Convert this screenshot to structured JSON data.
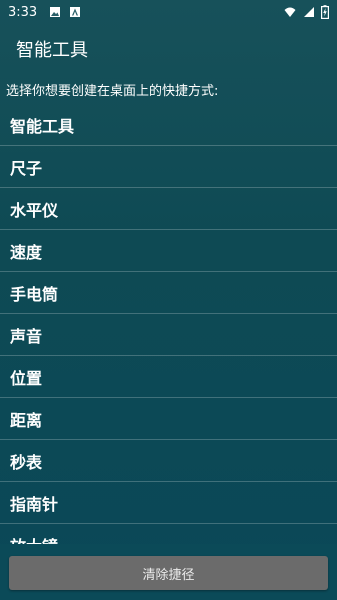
{
  "status_bar": {
    "time": "3:33",
    "left_icons": [
      "image-icon",
      "a-letter-icon"
    ],
    "right_icons": [
      "wifi-icon",
      "signal-icon",
      "battery-charging-icon"
    ]
  },
  "header": {
    "title": "智能工具"
  },
  "prompt_text": "选择你想要创建在桌面上的快捷方式:",
  "shortcuts": [
    {
      "label": "智能工具"
    },
    {
      "label": "尺子"
    },
    {
      "label": "水平仪"
    },
    {
      "label": "速度"
    },
    {
      "label": "手电筒"
    },
    {
      "label": "声音"
    },
    {
      "label": "位置"
    },
    {
      "label": "距离"
    },
    {
      "label": "秒表"
    },
    {
      "label": "指南针"
    },
    {
      "label": "放大镜"
    }
  ],
  "footer": {
    "clear_button_label": "清除捷径"
  },
  "colors": {
    "background": "#0e4a54",
    "button": "#6b6b6b",
    "text": "#ffffff"
  }
}
